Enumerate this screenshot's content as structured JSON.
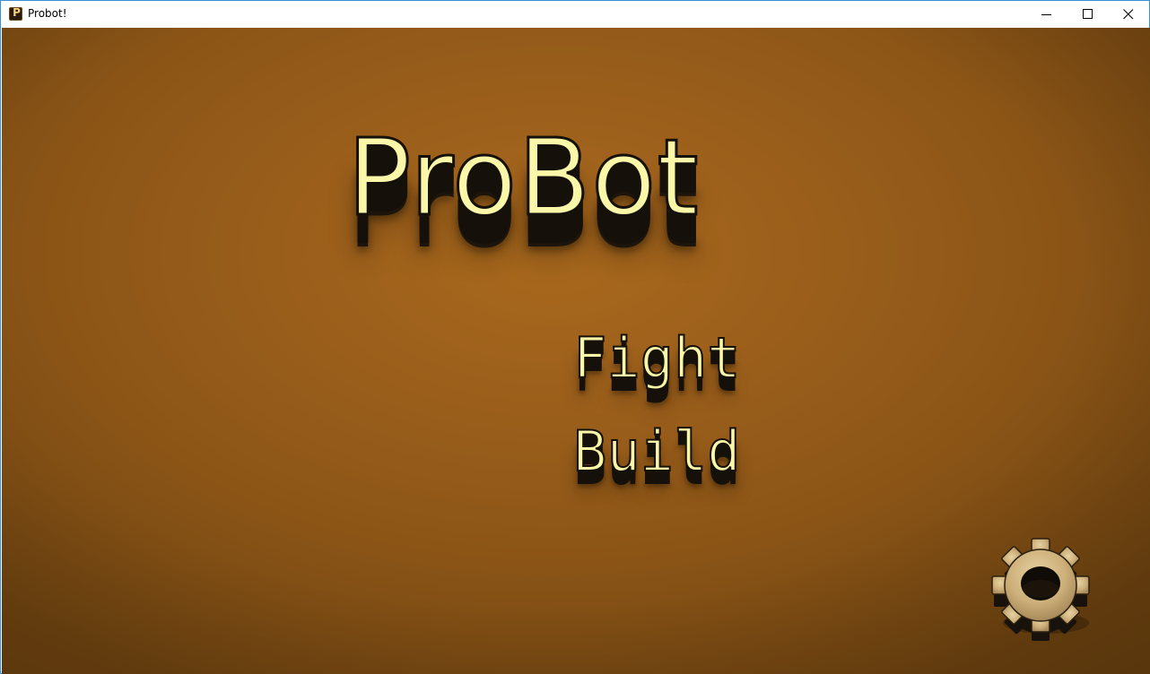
{
  "window": {
    "title": "Probot!",
    "app_icon_letter": "P",
    "controls": {
      "minimize": "minimize-icon",
      "maximize": "maximize-icon",
      "close": "close-icon"
    }
  },
  "game": {
    "logo_text": "ProBot",
    "menu": [
      {
        "label": "Fight"
      },
      {
        "label": "Build"
      }
    ],
    "settings_icon": "gear-icon"
  },
  "colors": {
    "background": "#9a5e1b",
    "text_face": "#fbf7a8",
    "text_extrusion": "#15110a",
    "gear_face": "#d8bf8a",
    "window_border": "#3c8fd6"
  }
}
